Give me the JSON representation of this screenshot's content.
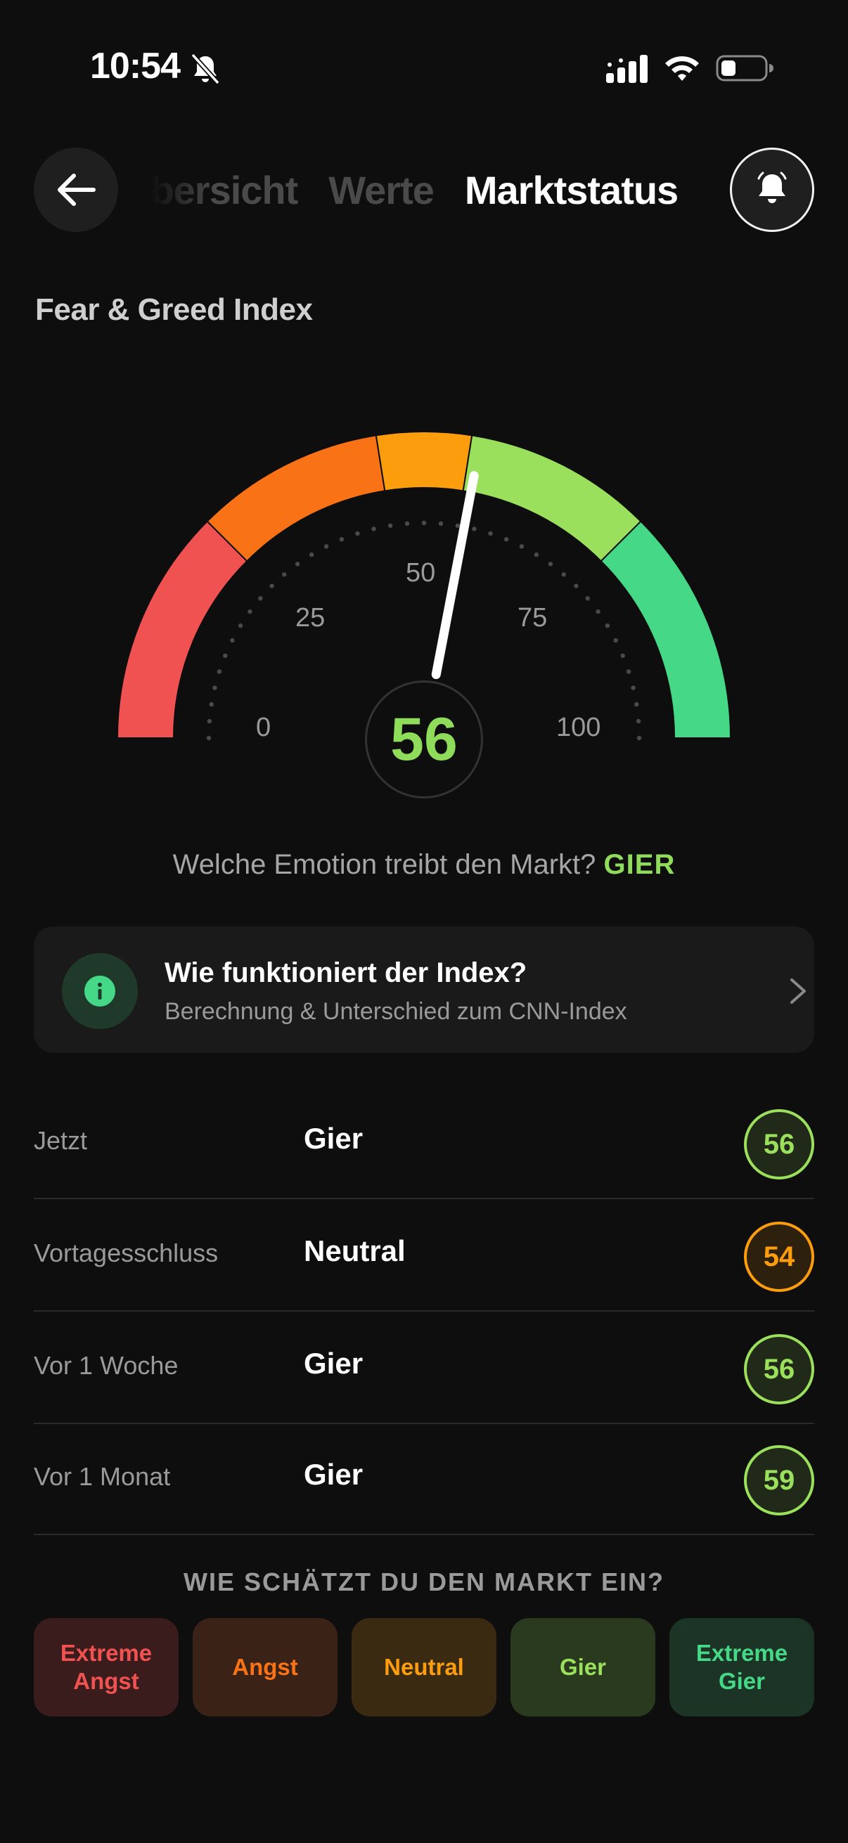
{
  "status_bar": {
    "time": "10:54"
  },
  "header": {
    "tabs": [
      {
        "label": "Übersicht",
        "state": "previous"
      },
      {
        "label": "Werte",
        "state": "previous"
      },
      {
        "label": "Marktstatus",
        "state": "active"
      }
    ]
  },
  "section": {
    "title": "Fear & Greed Index"
  },
  "gauge": {
    "value": 56,
    "min": 0,
    "max": 100,
    "tick_labels": [
      "0",
      "25",
      "50",
      "75",
      "100"
    ],
    "segments": [
      {
        "from": 0,
        "to": 25,
        "color": "#f05252"
      },
      {
        "from": 25,
        "to": 45,
        "color": "#f97316"
      },
      {
        "from": 45,
        "to": 55,
        "color": "#fb9d0c"
      },
      {
        "from": 55,
        "to": 75,
        "color": "#9be05c"
      },
      {
        "from": 75,
        "to": 100,
        "color": "#45d987"
      }
    ]
  },
  "question": {
    "text": "Welche Emotion treibt den Markt?",
    "answer": "GIER"
  },
  "info_card": {
    "title": "Wie funktioniert der Index?",
    "subtitle": "Berechnung & Unterschied zum CNN-Index"
  },
  "history": [
    {
      "label": "Jetzt",
      "value": "Gier",
      "score": "56",
      "color": "#9be05c"
    },
    {
      "label": "Vortagesschluss",
      "value": "Neutral",
      "score": "54",
      "color": "#fb9d0c"
    },
    {
      "label": "Vor 1 Woche",
      "value": "Gier",
      "score": "56",
      "color": "#9be05c"
    },
    {
      "label": "Vor 1 Monat",
      "value": "Gier",
      "score": "59",
      "color": "#9be05c"
    }
  ],
  "vote": {
    "title": "WIE SCHÄTZT DU DEN MARKT EIN?",
    "options": [
      {
        "label": "Extreme Angst",
        "color": "#f05252",
        "bg": "#3b1c1c"
      },
      {
        "label": "Angst",
        "color": "#f97316",
        "bg": "#3a2216"
      },
      {
        "label": "Neutral",
        "color": "#fb9d0c",
        "bg": "#3b2a12"
      },
      {
        "label": "Gier",
        "color": "#9be05c",
        "bg": "#2a3a1e"
      },
      {
        "label": "Extreme Gier",
        "color": "#45d987",
        "bg": "#1b3426"
      }
    ]
  }
}
